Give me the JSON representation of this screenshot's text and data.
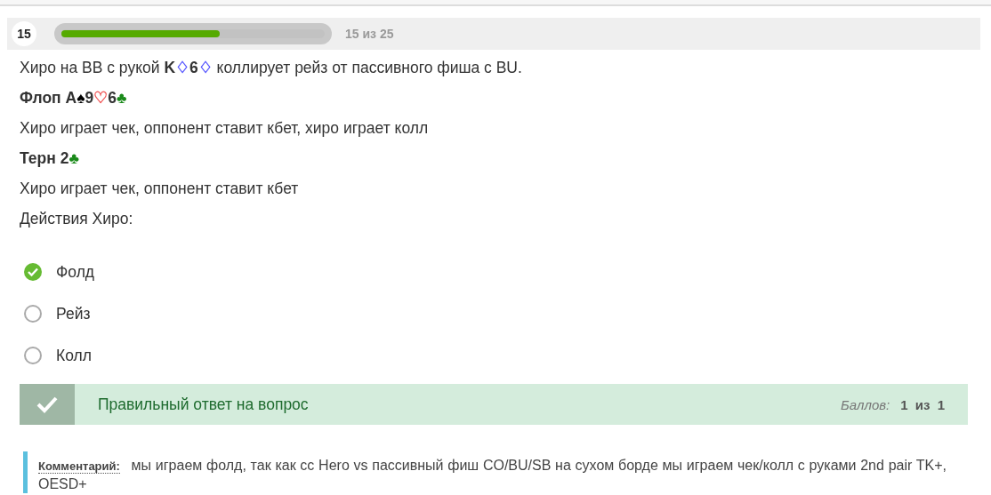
{
  "progress": {
    "number": "15",
    "level": 0.6,
    "label": "15 из 25"
  },
  "question": [
    {
      "kind": "text",
      "parts": [
        {
          "text": "Хиро на BB с рукой "
        },
        {
          "text": "K",
          "bold": true
        },
        {
          "text": "♢",
          "color": "#5555ff"
        },
        {
          "text": "6",
          "bold": true
        },
        {
          "text": "♢",
          "color": "#5555ff"
        },
        {
          "text": " коллирует рейз от пассивного фиша с BU."
        }
      ]
    },
    {
      "kind": "heading",
      "parts": [
        {
          "text": "Флоп A"
        },
        {
          "text": "♠",
          "color": "#000000"
        },
        {
          "text": "9"
        },
        {
          "text": "♡",
          "color": "#f05050"
        },
        {
          "text": "6"
        },
        {
          "text": "♣",
          "color": "#1a8a1a"
        }
      ]
    },
    {
      "kind": "text",
      "parts": [
        {
          "text": "Хиро играет чек, оппонент ставит кбет, хиро играет колл"
        }
      ]
    },
    {
      "kind": "heading",
      "parts": [
        {
          "text": "Терн 2"
        },
        {
          "text": "♣",
          "color": "#1a8a1a"
        }
      ]
    },
    {
      "kind": "text",
      "parts": [
        {
          "text": "Хиро играет чек, оппонент ставит кбет"
        }
      ]
    },
    {
      "kind": "text",
      "parts": [
        {
          "text": "Действия Хиро:"
        }
      ]
    }
  ],
  "options": [
    {
      "label": "Фолд",
      "selected": true
    },
    {
      "label": "Рейз",
      "selected": false
    },
    {
      "label": "Колл",
      "selected": false
    }
  ],
  "feedback": {
    "correct": true,
    "message": "Правильный ответ на вопрос",
    "score_label": "Баллов:",
    "score": "1",
    "of": "из",
    "max": "1"
  },
  "comment": {
    "label": "Комментарий:",
    "text": "мы играем фолд, так как сс Hero vs пассивный фиш CO/BU/SB на сухом борде мы играем чек/колл с руками 2nd pair TK+, OESD+"
  }
}
